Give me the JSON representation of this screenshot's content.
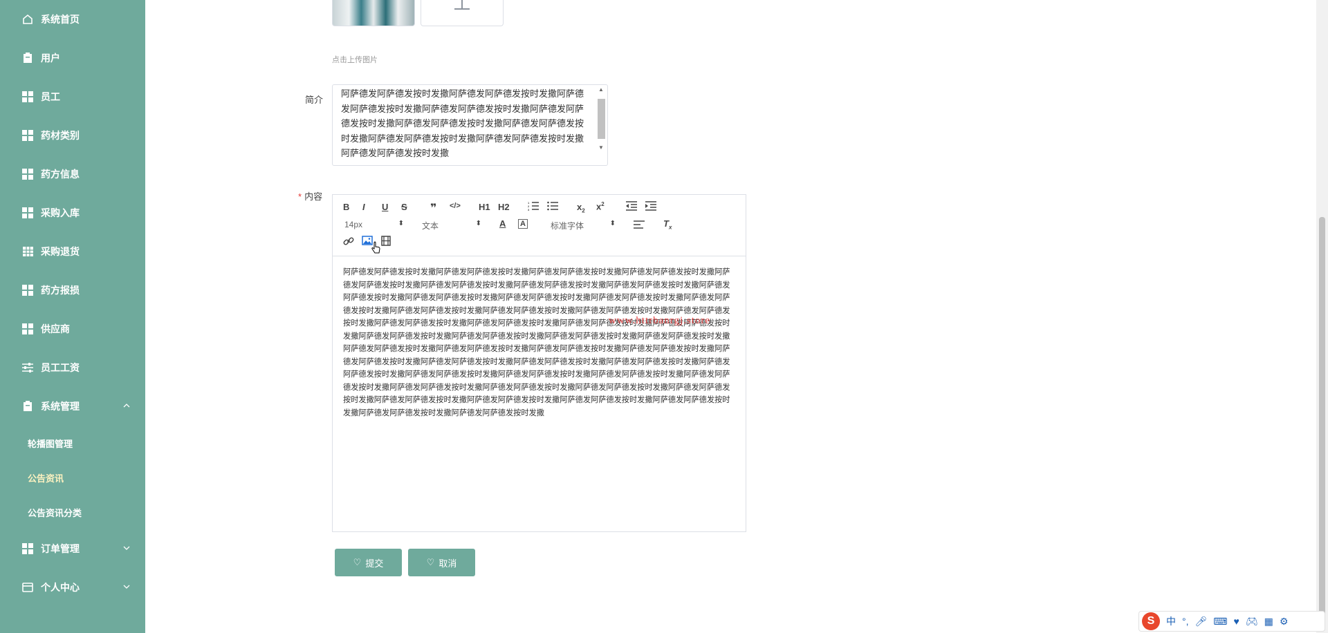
{
  "sidebar": {
    "items": [
      {
        "label": "系统首页",
        "icon": "home-icon"
      },
      {
        "label": "用户",
        "icon": "clipboard-icon"
      },
      {
        "label": "员工",
        "icon": "grid-icon"
      },
      {
        "label": "药材类别",
        "icon": "grid-icon"
      },
      {
        "label": "药方信息",
        "icon": "grid-icon"
      },
      {
        "label": "采购入库",
        "icon": "grid-icon"
      },
      {
        "label": "采购退货",
        "icon": "table-icon"
      },
      {
        "label": "药方报损",
        "icon": "grid-icon"
      },
      {
        "label": "供应商",
        "icon": "grid-icon"
      },
      {
        "label": "员工工资",
        "icon": "sliders-icon"
      },
      {
        "label": "系统管理",
        "icon": "clipboard-icon"
      },
      {
        "label": "订单管理",
        "icon": "grid-icon"
      },
      {
        "label": "个人中心",
        "icon": "card-icon"
      }
    ],
    "sub_items": [
      "轮播图管理",
      "公告资讯",
      "公告资讯分类"
    ]
  },
  "form": {
    "upload_hint": "点击上传图片",
    "intro_label": "简介",
    "intro_value": "阿萨德发阿萨德发按时发撒阿萨德发阿萨德发按时发撒阿萨德发阿萨德发按时发撒阿萨德发阿萨德发按时发撒阿萨德发阿萨德发按时发撒阿萨德发阿萨德发按时发撒阿萨德发阿萨德发按时发撒阿萨德发阿萨德发按时发撒阿萨德发阿萨德发按时发撒阿萨德发阿萨德发按时发撒",
    "content_required": "*",
    "content_label": "内容",
    "content_value": "阿萨德发阿萨德发按时发撒阿萨德发阿萨德发按时发撒阿萨德发阿萨德发按时发撒阿萨德发阿萨德发按时发撒阿萨德发阿萨德发按时发撒阿萨德发阿萨德发按时发撒阿萨德发阿萨德发按时发撒阿萨德发阿萨德发按时发撒阿萨德发阿萨德发按时发撒阿萨德发阿萨德发按时发撒阿萨德发阿萨德发按时发撒阿萨德发阿萨德发按时发撒阿萨德发阿萨德发按时发撒阿萨德发阿萨德发按时发撒阿萨德发阿萨德发按时发撒阿萨德发阿萨德发按时发撒阿萨德发阿萨德发按时发撒阿萨德发阿萨德发按时发撒阿萨德发阿萨德发按时发撒阿萨德发阿萨德发按时发撒阿萨德发阿萨德发按时发撒阿萨德发阿萨德发按时发撒阿萨德发阿萨德发按时发撒阿萨德发阿萨德发按时发撒阿萨德发阿萨德发按时发撒阿萨德发阿萨德发按时发撒阿萨德发阿萨德发按时发撒阿萨德发阿萨德发按时发撒阿萨德发阿萨德发按时发撒阿萨德发阿萨德发按时发撒阿萨德发阿萨德发按时发撒阿萨德发阿萨德发按时发撒阿萨德发阿萨德发按时发撒阿萨德发阿萨德发按时发撒阿萨德发阿萨德发按时发撒阿萨德发阿萨德发按时发撒阿萨德发阿萨德发按时发撒阿萨德发阿萨德发按时发撒阿萨德发阿萨德发按时发撒阿萨德发阿萨德发按时发撒阿萨德发阿萨德发按时发撒阿萨德发阿萨德发按时发撒阿萨德发阿萨德发按时发撒阿萨德发阿萨德发按时发撒阿萨德发阿萨德发按时发撒阿萨德发阿萨德发按时发撒阿萨德发阿萨德发按时发撒阿萨德发阿萨德发按时发撒",
    "submit_label": "提交",
    "cancel_label": "取消"
  },
  "editor": {
    "font_size": "14px",
    "text_style": "文本",
    "font_family": "标准字体",
    "h1": "H1",
    "h2": "H2"
  },
  "watermark": "www.httrbanrgj.store",
  "ime": {
    "lang": "中"
  },
  "colors": {
    "accent": "#6faa9c",
    "required": "#e53935"
  }
}
